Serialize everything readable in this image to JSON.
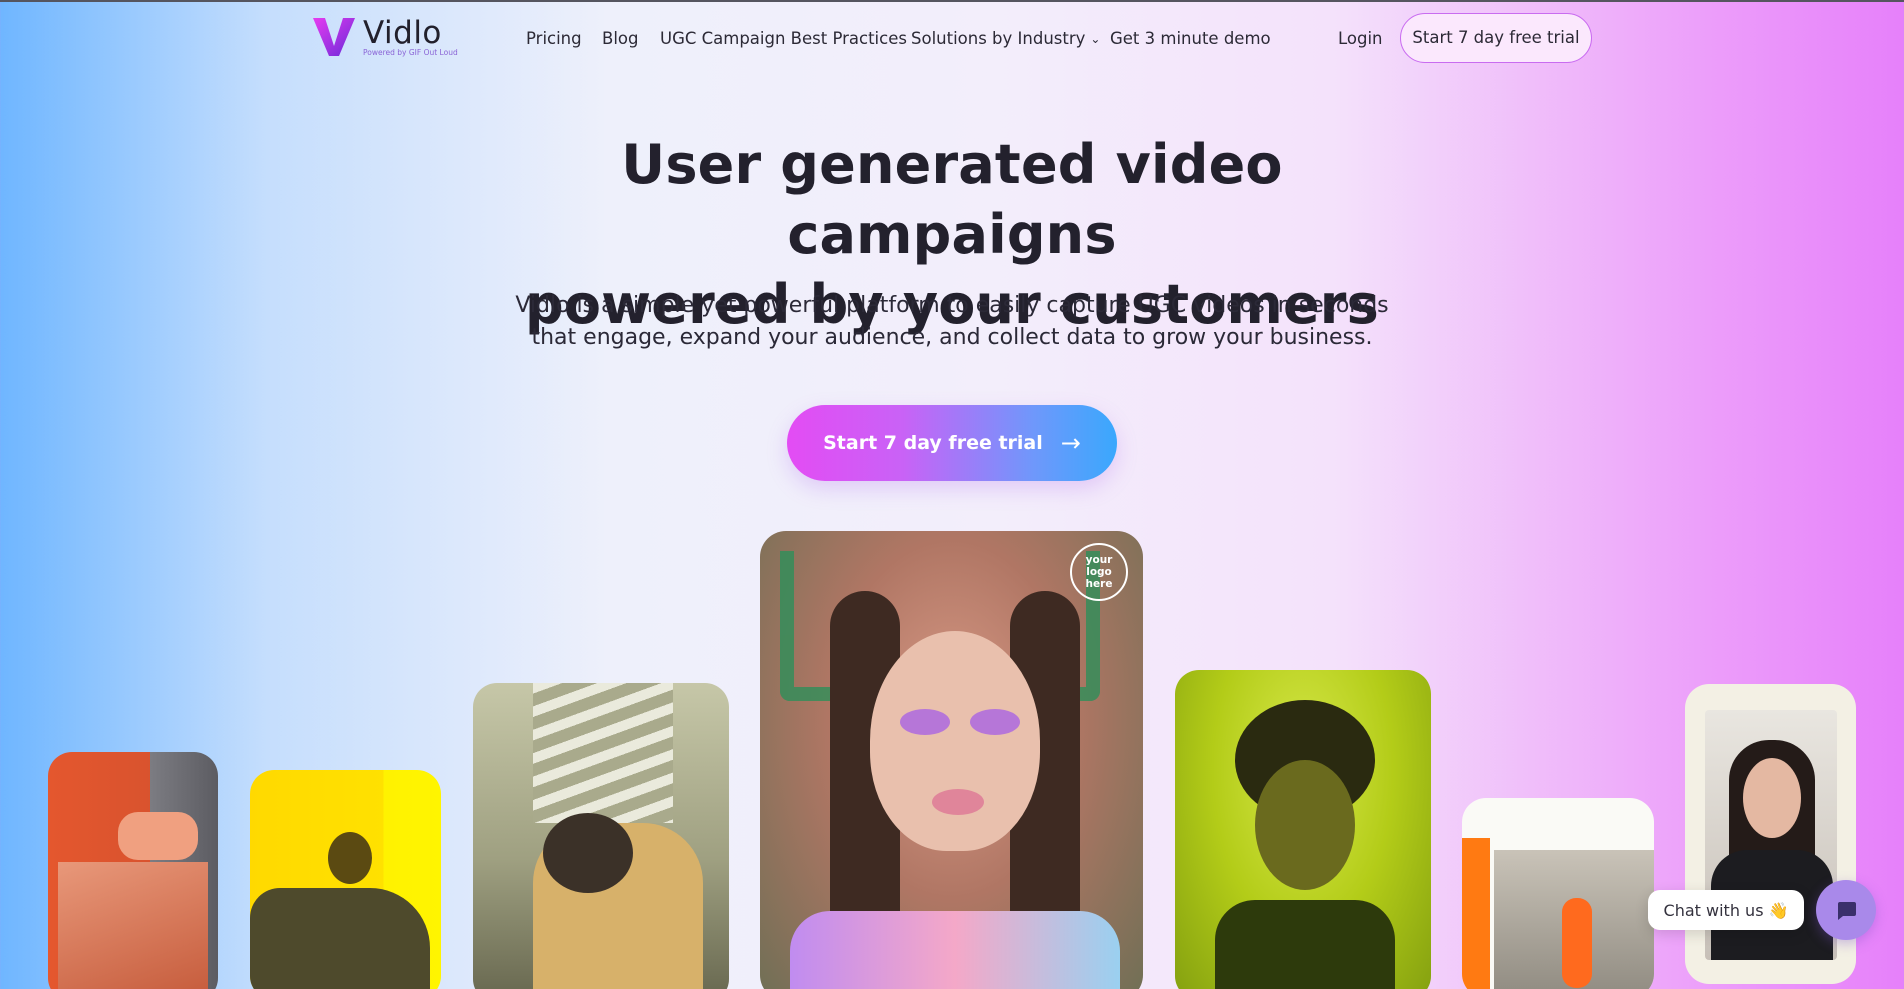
{
  "brand": {
    "name": "Vidlo",
    "tagline": "Powered by GIF Out Loud",
    "colors": {
      "accent_start": "#e34cf4",
      "accent_end": "#3aa8fd",
      "logo": "#b23ce8"
    }
  },
  "nav": {
    "items": [
      {
        "label": "Pricing"
      },
      {
        "label": "Blog"
      },
      {
        "label": "UGC Campaign Best Practices"
      },
      {
        "label": "Solutions by Industry"
      },
      {
        "label": "Get 3 minute demo"
      }
    ],
    "login": "Login",
    "trial": "Start 7 day free trial"
  },
  "hero": {
    "title_line1": "User generated video campaigns",
    "title_line2": "powered by your customers",
    "subtitle_line1": "Vidlo is a simple yet powerful platform to easily capture UGC videos in seconds",
    "subtitle_line2": "that engage, expand your audience, and collect data to grow your business.",
    "cta_label": "Start 7 day free trial"
  },
  "showcase": {
    "logo_badge": [
      "your",
      "logo",
      "here"
    ]
  },
  "chat": {
    "label": "Chat with us",
    "emoji": "👋"
  }
}
